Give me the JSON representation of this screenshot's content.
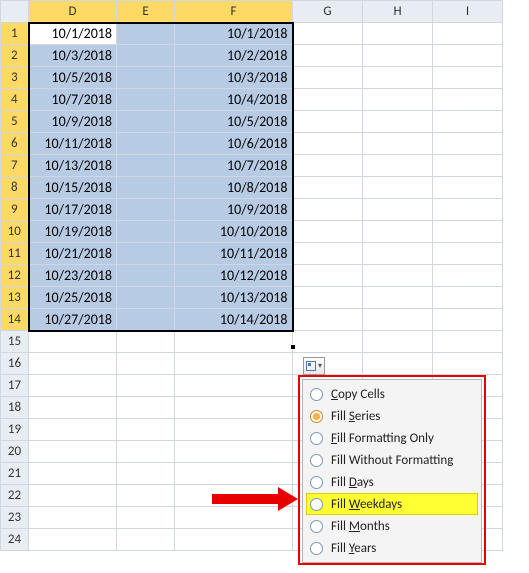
{
  "columns": [
    "D",
    "E",
    "F",
    "G",
    "H",
    "I"
  ],
  "active_columns": [
    "D",
    "E",
    "F"
  ],
  "row_count": 24,
  "active_rows": [
    1,
    2,
    3,
    4,
    5,
    6,
    7,
    8,
    9,
    10,
    11,
    12,
    13,
    14
  ],
  "data_D": [
    "10/1/2018",
    "10/3/2018",
    "10/5/2018",
    "10/7/2018",
    "10/9/2018",
    "10/11/2018",
    "10/13/2018",
    "10/15/2018",
    "10/17/2018",
    "10/19/2018",
    "10/21/2018",
    "10/23/2018",
    "10/25/2018",
    "10/27/2018"
  ],
  "data_F": [
    "10/1/2018",
    "10/2/2018",
    "10/3/2018",
    "10/4/2018",
    "10/5/2018",
    "10/6/2018",
    "10/7/2018",
    "10/8/2018",
    "10/9/2018",
    "10/10/2018",
    "10/11/2018",
    "10/12/2018",
    "10/13/2018",
    "10/14/2018"
  ],
  "menu": {
    "items": [
      {
        "label": "Copy Cells",
        "accel": "C",
        "selected": false,
        "highlight": false
      },
      {
        "label": "Fill Series",
        "accel": "S",
        "selected": true,
        "highlight": false
      },
      {
        "label": "Fill Formatting Only",
        "accel": "F",
        "selected": false,
        "highlight": false
      },
      {
        "label": "Fill Without Formatting",
        "accel": "O",
        "selected": false,
        "highlight": false
      },
      {
        "label": "Fill Days",
        "accel": "D",
        "selected": false,
        "highlight": false
      },
      {
        "label": "Fill Weekdays",
        "accel": "W",
        "selected": false,
        "highlight": true
      },
      {
        "label": "Fill Months",
        "accel": "M",
        "selected": false,
        "highlight": false
      },
      {
        "label": "Fill Years",
        "accel": "Y",
        "selected": false,
        "highlight": false
      }
    ]
  }
}
